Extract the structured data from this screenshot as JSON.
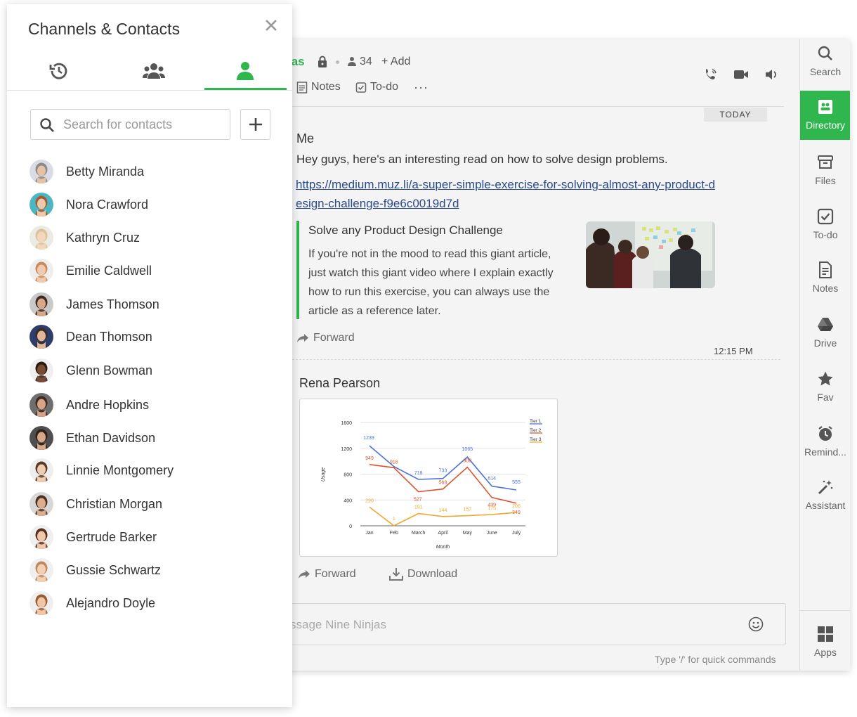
{
  "panel": {
    "title": "Channels & Contacts",
    "search_placeholder": "Search for contacts",
    "contacts": [
      {
        "name": "Betty Miranda",
        "skin": "#e8c2a4",
        "hair": "#8a8a8a",
        "bg": "#d9dde3"
      },
      {
        "name": "Nora Crawford",
        "skin": "#f0c9a8",
        "hair": "#a35b2e",
        "bg": "#4bb7c4"
      },
      {
        "name": "Kathryn Cruz",
        "skin": "#f3d6bd",
        "hair": "#d9c49a",
        "bg": "#eceae4"
      },
      {
        "name": "Emilie Caldwell",
        "skin": "#f1cbb0",
        "hair": "#c98a5a",
        "bg": "#eeeeee"
      },
      {
        "name": "James Thomson",
        "skin": "#d9a888",
        "hair": "#3a2b24",
        "bg": "#c9c9c9"
      },
      {
        "name": "Dean Thomson",
        "skin": "#e0b898",
        "hair": "#3a2b24",
        "bg": "#2d3e6b"
      },
      {
        "name": "Glenn Bowman",
        "skin": "#7b4a32",
        "hair": "#2a1a12",
        "bg": "#efefef"
      },
      {
        "name": "Andre Hopkins",
        "skin": "#d7a487",
        "hair": "#3d2a20",
        "bg": "#6e6e6e"
      },
      {
        "name": "Ethan Davidson",
        "skin": "#d9a888",
        "hair": "#2f2119",
        "bg": "#4f4f4f"
      },
      {
        "name": "Linnie Montgomery",
        "skin": "#f0ccb0",
        "hair": "#5a3a26",
        "bg": "#eeeeee"
      },
      {
        "name": "Christian Morgan",
        "skin": "#dcae8e",
        "hair": "#4a3020",
        "bg": "#d8d8d8"
      },
      {
        "name": "Gertrude Barker",
        "skin": "#f0c9ad",
        "hair": "#5a2e1c",
        "bg": "#efefef"
      },
      {
        "name": "Gussie Schwartz",
        "skin": "#f2d0b4",
        "hair": "#c0895a",
        "bg": "#efefef"
      },
      {
        "name": "Alejandro Doyle",
        "skin": "#efc6a6",
        "hair": "#9a5a34",
        "bg": "#efefef"
      }
    ]
  },
  "chat": {
    "channel_name": "jas",
    "members_count": "34",
    "add_label": "+ Add",
    "tabs": {
      "notes": "Notes",
      "todo": "To-do"
    },
    "more": "···",
    "today_label": "TODAY",
    "message1": {
      "sender": "Me",
      "text": "Hey guys, here's an interesting read on how to solve design problems.",
      "link": "https://medium.muz.li/a-super-simple-exercise-for-solving-almost-any-product-design-challenge-f9e6c0019d7d",
      "preview_title": "Solve any Product Design Challenge",
      "preview_desc": "If you're not in the mood to read this giant article, just watch this giant video where I explain exactly how to run this exercise, you can always use the article as a reference later.",
      "forward": "Forward",
      "time": "12:15 PM"
    },
    "message2": {
      "sender": "Rena Pearson",
      "forward": "Forward",
      "download": "Download"
    },
    "composer_placeholder": "ssage Nine Ninjas",
    "hint": "Type '/' for quick commands"
  },
  "rail": {
    "items": [
      "Search",
      "Directory",
      "Files",
      "To-do",
      "Notes",
      "Drive",
      "Fav",
      "Remind...",
      "Assistant"
    ],
    "apps": "Apps"
  },
  "colors": {
    "accent": "#2fb64d",
    "tier1": "#4a72d9",
    "tier2": "#d9542e",
    "tier3": "#f0a830"
  },
  "chart_data": {
    "type": "line",
    "title": "",
    "xlabel": "Month",
    "ylabel": "Usage",
    "categories": [
      "Jan",
      "Feb",
      "March",
      "April",
      "May",
      "June",
      "July"
    ],
    "ylim": [
      0,
      1600
    ],
    "yticks": [
      0,
      400,
      800,
      1200,
      1600
    ],
    "legend_position": "top-right",
    "series": [
      {
        "name": "Tier 1",
        "values": [
          1239,
          918,
          718,
          733,
          1065,
          614,
          555
        ],
        "labels": [
          "1239",
          "",
          "718",
          "733",
          "1065",
          "614",
          "555"
        ]
      },
      {
        "name": "Tier 2",
        "values": [
          949,
          900,
          527,
          569,
          908,
          439,
          349
        ],
        "labels": [
          "949",
          "918",
          "527",
          "569",
          "908",
          "439",
          "349"
        ]
      },
      {
        "name": "Tier 3",
        "values": [
          290,
          1,
          191,
          144,
          157,
          175,
          206
        ],
        "labels": [
          "290",
          "1",
          "191",
          "144",
          "157",
          "175",
          "206"
        ]
      }
    ]
  }
}
